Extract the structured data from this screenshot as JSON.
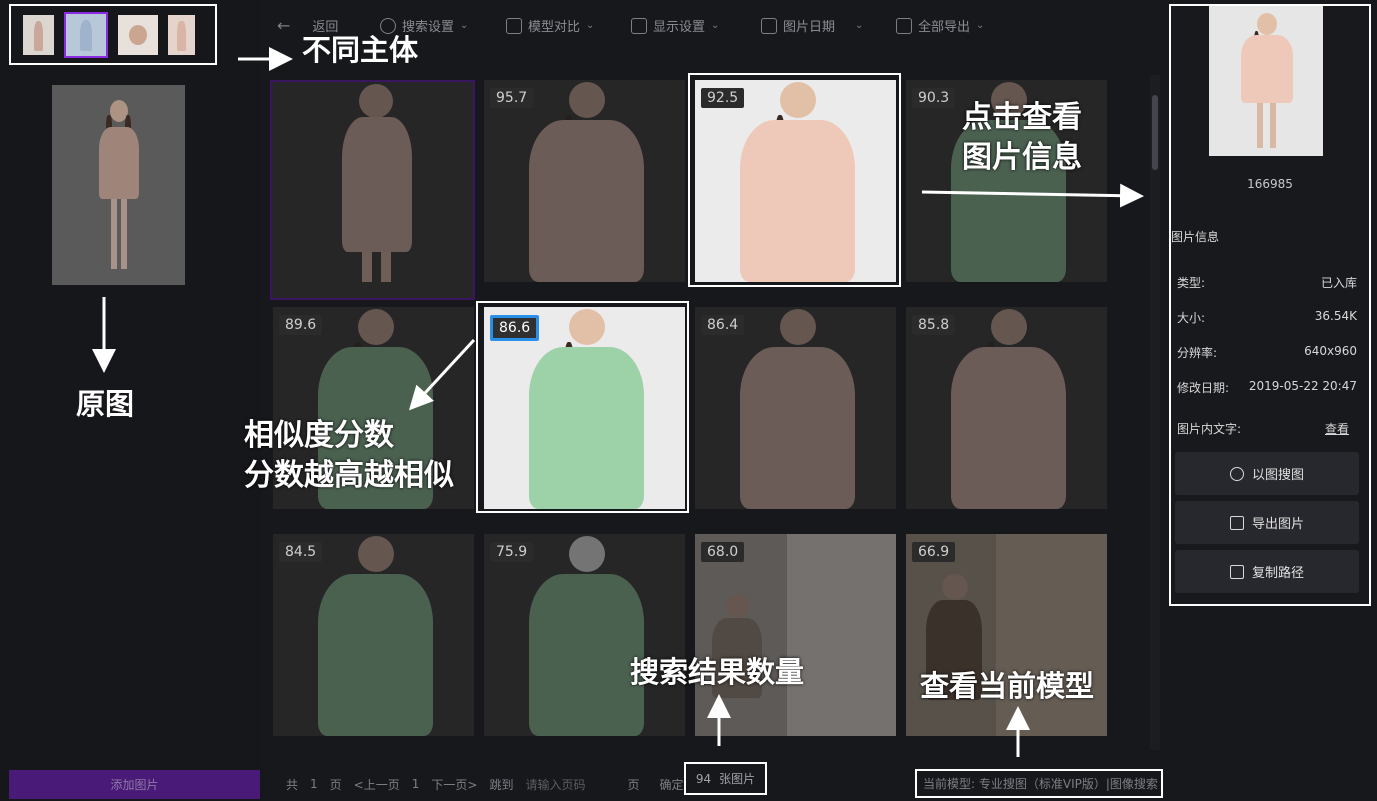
{
  "toolbar": {
    "back": "返回",
    "search_settings": "搜索设置",
    "model_compare": "模型对比",
    "display_settings": "显示设置",
    "image_date": "图片日期",
    "export_all": "全部导出"
  },
  "left": {
    "add_button": "添加图片"
  },
  "grid": {
    "scores": [
      "",
      "95.7",
      "92.5",
      "90.3",
      "89.6",
      "86.6",
      "86.4",
      "85.8",
      "84.5",
      "75.9",
      "68.0",
      "66.9"
    ]
  },
  "annotations": {
    "subjects": "不同主体",
    "original": "原图",
    "click_view_line1": "点击查看",
    "click_view_line2": "图片信息",
    "similarity_line1": "相似度分数",
    "similarity_line2": "分数越高越相似",
    "result_count": "搜索结果数量",
    "current_model": "查看当前模型"
  },
  "pager": {
    "total": "共",
    "total_pages": "1",
    "page_unit": "页",
    "prev": "<上一页",
    "current": "1",
    "next": "下一页>",
    "jump": "跳到",
    "input_placeholder": "请输入页码",
    "page_unit2": "页",
    "confirm": "确定",
    "count": "94",
    "count_unit": "张图片",
    "model": "当前模型: 专业搜图（标准VIP版）|图像搜索"
  },
  "info": {
    "id": "166985",
    "section_title": "图片信息",
    "type_label": "类型:",
    "type_value": "已入库",
    "size_label": "大小:",
    "size_value": "36.54K",
    "res_label": "分辨率:",
    "res_value": "640x960",
    "date_label": "修改日期:",
    "date_value": "2019-05-22 20:47",
    "text_label": "图片内文字:",
    "text_value": "查看",
    "btn_search": "以图搜图",
    "btn_export": "导出图片",
    "btn_copy": "复制路径"
  },
  "colors": {
    "accent": "#8a2be2",
    "highlight": "#2a8fe8",
    "background": "#17181c"
  }
}
